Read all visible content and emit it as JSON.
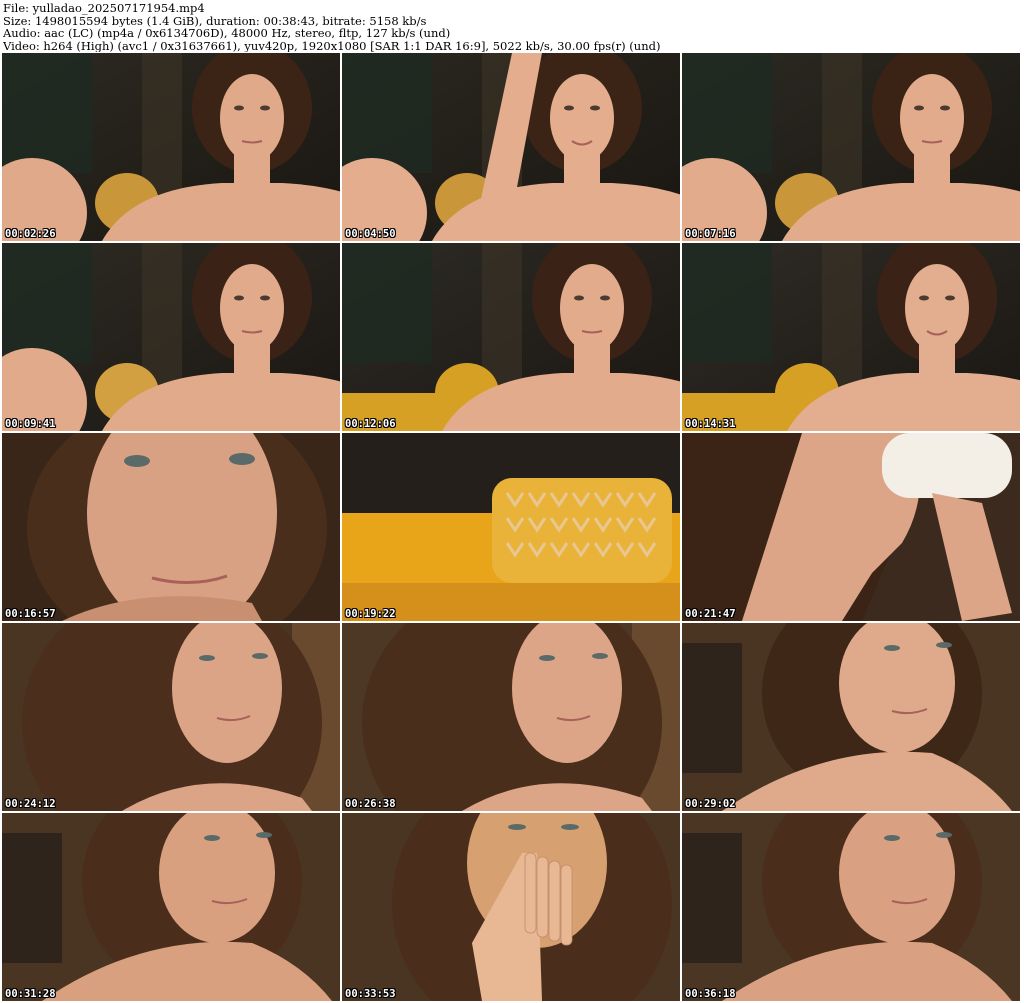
{
  "header": {
    "file_line": "File: yulladao_202507171954.mp4",
    "size_line": "Size: 1498015594 bytes (1.4 GiB), duration: 00:38:43, bitrate: 5158 kb/s",
    "audio_line": "Audio: aac (LC) (mp4a / 0x6134706D), 48000 Hz, stereo, fltp, 127 kb/s (und)",
    "video_line": "Video: h264 (High) (avc1 / 0x31637661), yuv420p, 1920x1080 [SAR 1:1 DAR 16:9], 5022 kb/s, 30.00 fps(r) (und)"
  },
  "thumbnails": [
    {
      "timestamp": "00:02:26",
      "scene": "portrait-shoulders-pillow",
      "bg": "#2c2a22",
      "skin": "#e0a98a",
      "hair": "#3b2416",
      "accent": "#c9973a"
    },
    {
      "timestamp": "00:04:50",
      "scene": "portrait-arm-raised",
      "bg": "#2a2820",
      "skin": "#e3ad8e",
      "hair": "#3b2416",
      "accent": "#c9973a"
    },
    {
      "timestamp": "00:07:16",
      "scene": "portrait-shoulders-pillow",
      "bg": "#2b2a22",
      "skin": "#e2ac8c",
      "hair": "#3a2315",
      "accent": "#c9973a"
    },
    {
      "timestamp": "00:09:41",
      "scene": "portrait-shoulders-pillow",
      "bg": "#2e2b24",
      "skin": "#e1aa8b",
      "hair": "#3a2316",
      "accent": "#d2a040"
    },
    {
      "timestamp": "00:12:06",
      "scene": "portrait-sofa",
      "bg": "#2d2b25",
      "skin": "#e2ab8c",
      "hair": "#3a2316",
      "accent": "#d6a024"
    },
    {
      "timestamp": "00:14:31",
      "scene": "portrait-sofa-smile",
      "bg": "#2f2c26",
      "skin": "#e3ad8f",
      "hair": "#3a2316",
      "accent": "#d6a024"
    },
    {
      "timestamp": "00:16:57",
      "scene": "closeup-face",
      "bg": "#3a2618",
      "skin": "#d9a184",
      "hair": "#4a2e1c",
      "accent": "#c88f70"
    },
    {
      "timestamp": "00:19:22",
      "scene": "pillow-only",
      "bg": "#241f1a",
      "skin": "#e8c790",
      "hair": "#d9a21f",
      "accent": "#e9a51a"
    },
    {
      "timestamp": "00:21:47",
      "scene": "drinking-cup",
      "bg": "#3d2a1f",
      "skin": "#dca588",
      "hair": "#3b2416",
      "accent": "#f3efe6"
    },
    {
      "timestamp": "00:24:12",
      "scene": "portrait-wavy-hair",
      "bg": "#4a3523",
      "skin": "#dca487",
      "hair": "#4b2e1c",
      "accent": "#6a4a2e"
    },
    {
      "timestamp": "00:26:38",
      "scene": "portrait-wavy-hair",
      "bg": "#4d3826",
      "skin": "#dca588",
      "hair": "#4a2e1c",
      "accent": "#6a4a2e"
    },
    {
      "timestamp": "00:29:02",
      "scene": "portrait-profile",
      "bg": "#4a3523",
      "skin": "#dfa98b",
      "hair": "#3f2717",
      "accent": "#6a4a2e"
    },
    {
      "timestamp": "00:31:28",
      "scene": "portrait-profile",
      "bg": "#4a3522",
      "skin": "#d9a080",
      "hair": "#4a2d1b",
      "accent": "#6a4a2e"
    },
    {
      "timestamp": "00:33:53",
      "scene": "hand-over-mouth",
      "bg": "#4a3422",
      "skin": "#d89e7f",
      "hair": "#4a2d1b",
      "accent": "#e8b895"
    },
    {
      "timestamp": "00:36:18",
      "scene": "portrait-profile",
      "bg": "#4b3623",
      "skin": "#d9a081",
      "hair": "#4b2d1b",
      "accent": "#6a4a2e"
    }
  ]
}
